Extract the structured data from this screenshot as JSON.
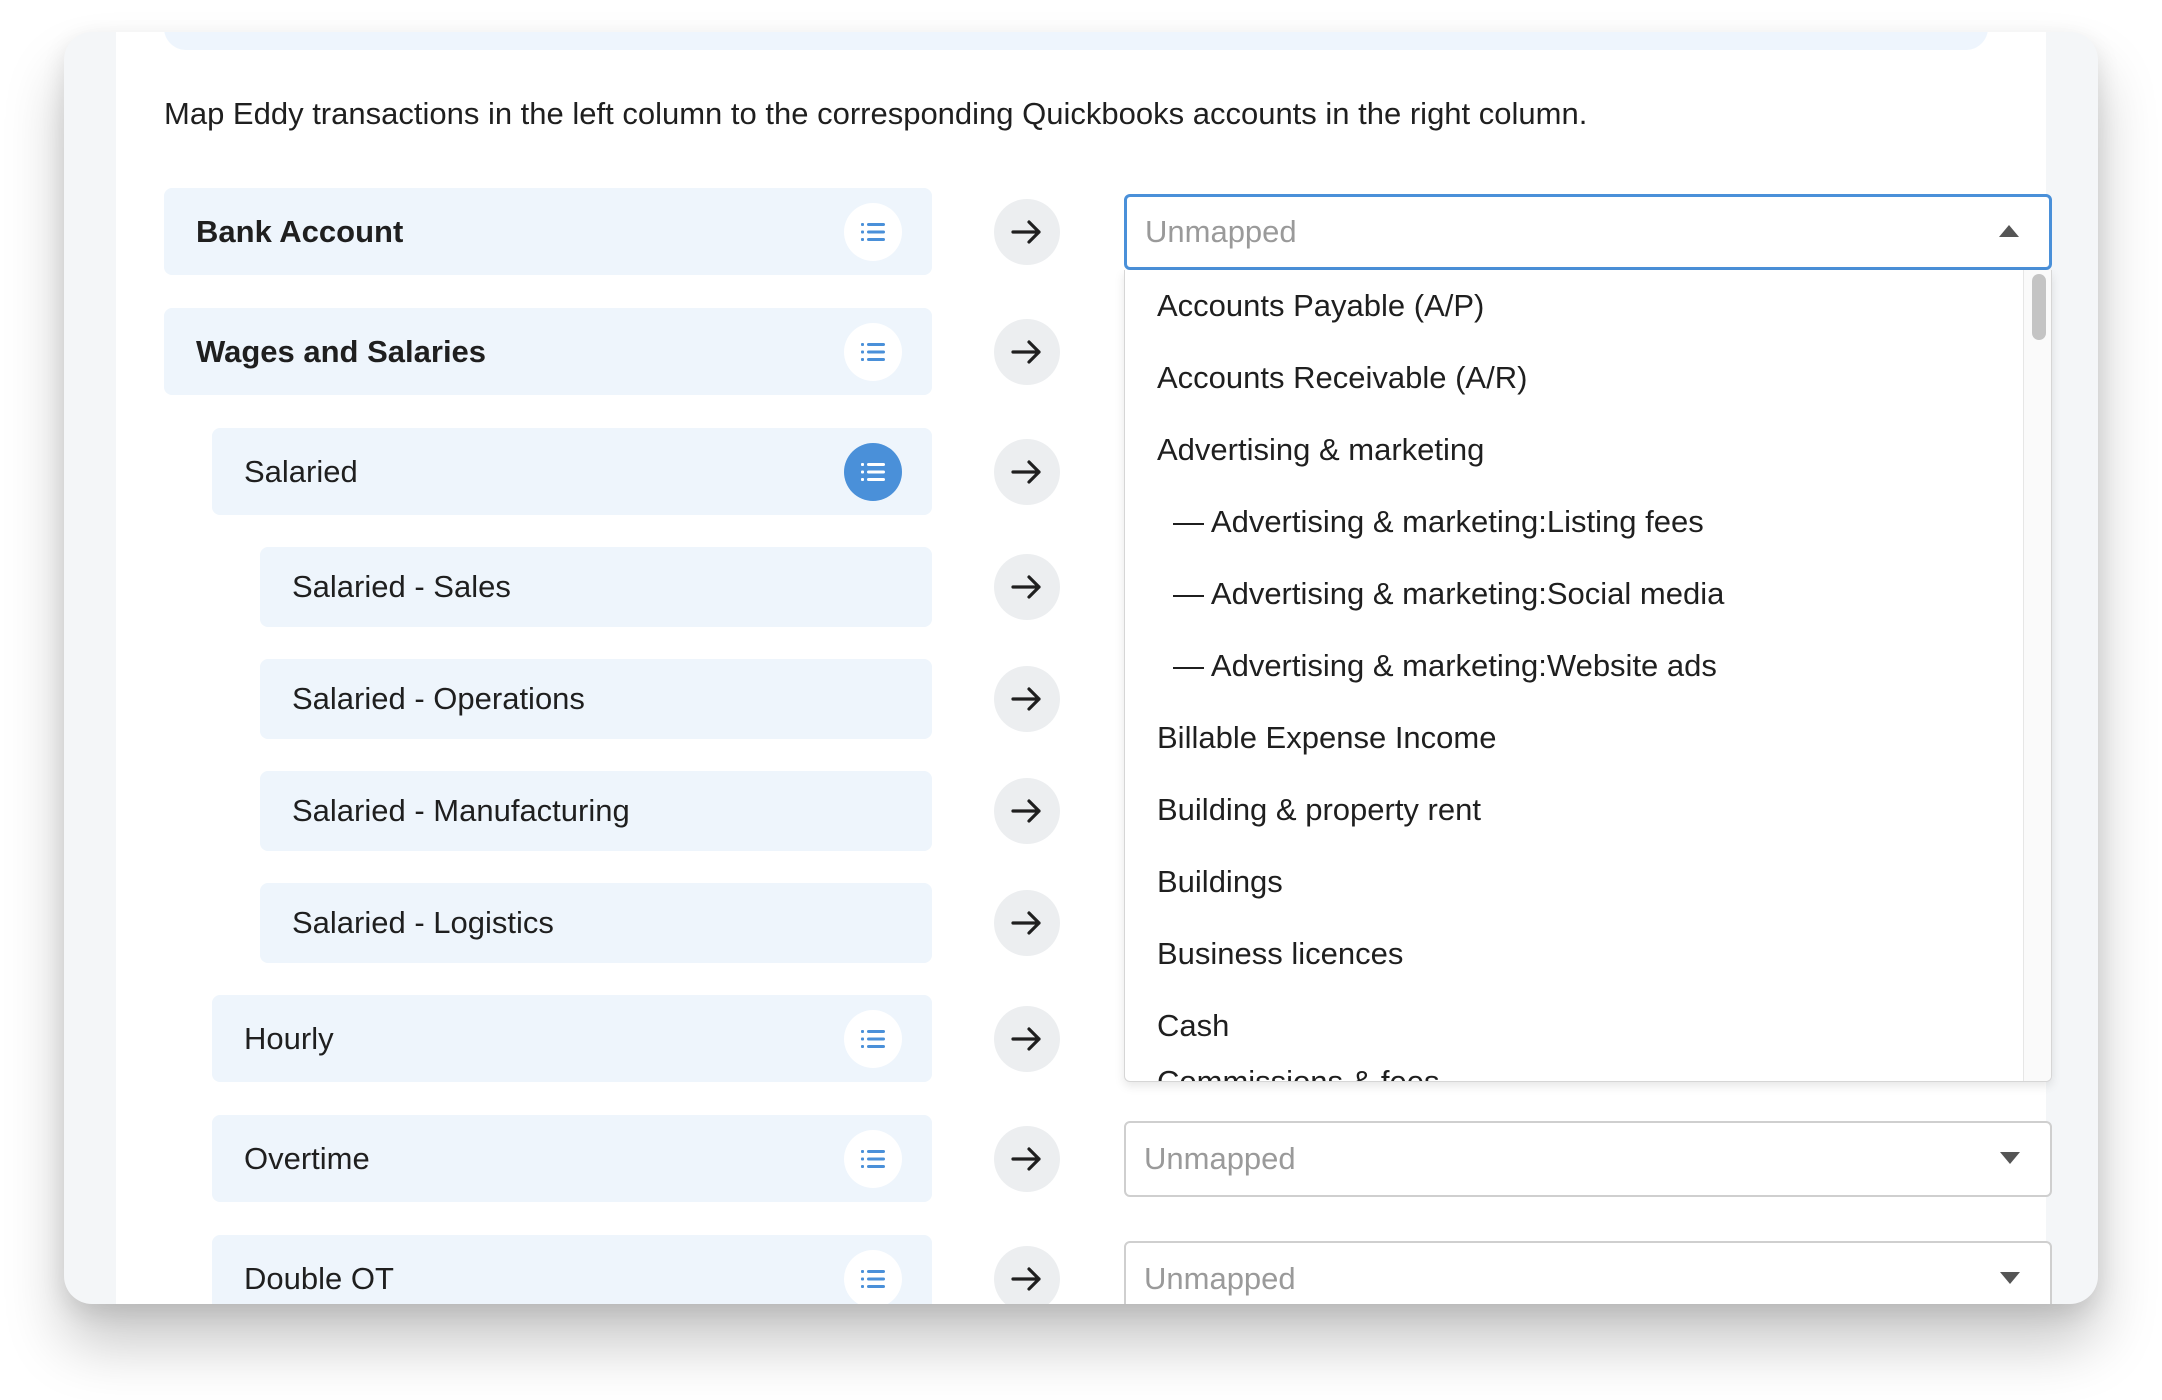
{
  "instructions": "Map Eddy transactions in the left column to the corresponding Quickbooks accounts in the right column.",
  "rows": [
    {
      "label": "Bank Account"
    },
    {
      "label": "Wages and Salaries"
    },
    {
      "label": "Salaried"
    },
    {
      "label": "Salaried - Sales"
    },
    {
      "label": "Salaried - Operations"
    },
    {
      "label": "Salaried - Manufacturing"
    },
    {
      "label": "Salaried - Logistics"
    },
    {
      "label": "Hourly"
    },
    {
      "label": "Overtime"
    },
    {
      "label": "Double OT"
    }
  ],
  "selects": {
    "placeholder": "Unmapped"
  },
  "dropdown": {
    "options": [
      "Accounts Payable (A/P)",
      "Accounts Receivable (A/R)",
      "Advertising & marketing",
      "— Advertising & marketing:Listing fees",
      "— Advertising & marketing:Social media",
      "— Advertising & marketing:Website ads",
      "Billable Expense Income",
      "Building & property rent",
      "Buildings",
      "Business licences",
      "Cash",
      "Commissions & fees"
    ]
  },
  "icons": {
    "list": "list-icon",
    "arrow": "arrow-right-icon",
    "caret_up": "caret-up-icon",
    "caret_down": "caret-down-icon"
  },
  "colors": {
    "accent": "#4a90d9",
    "row_bg": "#eef5fc",
    "placeholder": "#9a9a9a"
  }
}
